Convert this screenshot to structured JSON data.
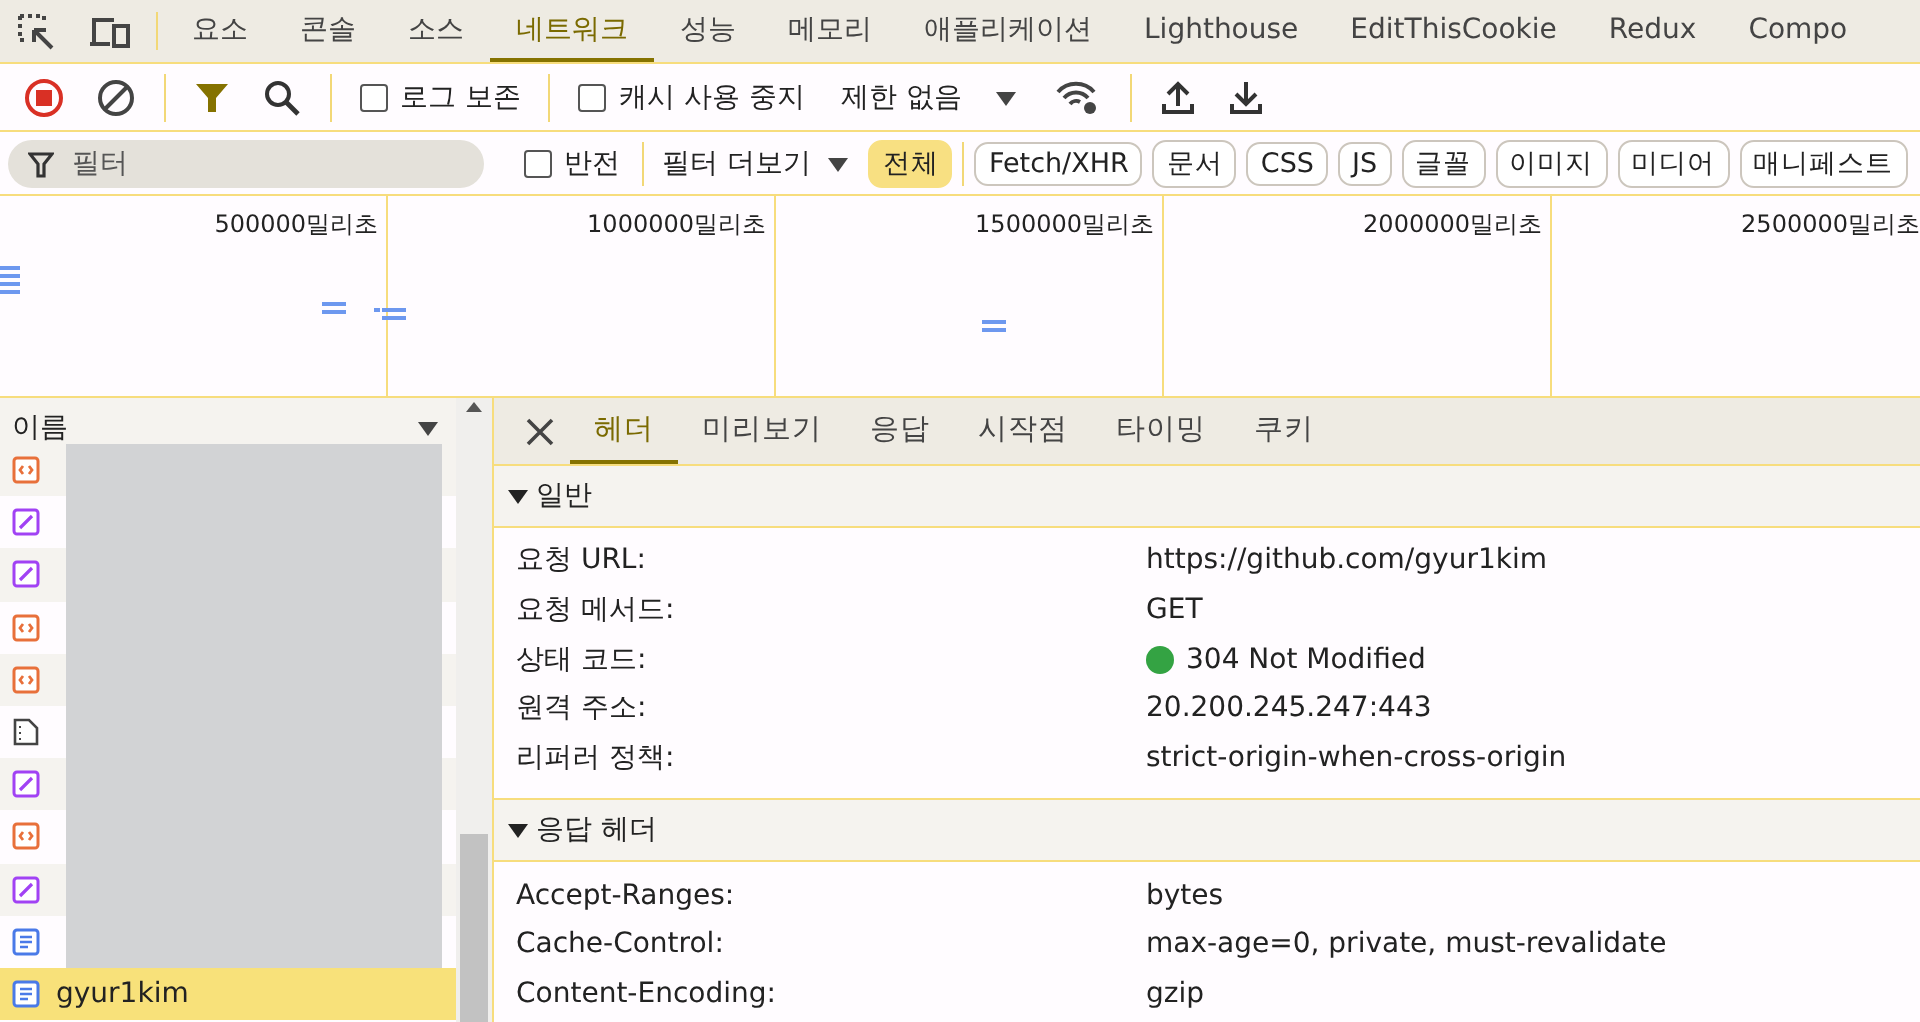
{
  "main_tabs": [
    {
      "label": "요소",
      "selected": false
    },
    {
      "label": "콘솔",
      "selected": false
    },
    {
      "label": "소스",
      "selected": false
    },
    {
      "label": "네트워크",
      "selected": true
    },
    {
      "label": "성능",
      "selected": false
    },
    {
      "label": "메모리",
      "selected": false
    },
    {
      "label": "애플리케이션",
      "selected": false
    },
    {
      "label": "Lighthouse",
      "selected": false
    },
    {
      "label": "EditThisCookie",
      "selected": false
    },
    {
      "label": "Redux",
      "selected": false
    },
    {
      "label": "Compo",
      "selected": false
    }
  ],
  "toolbar": {
    "recording": true,
    "filter_on": true,
    "preserve_log": {
      "label": "로그 보존",
      "checked": false
    },
    "disable_cache": {
      "label": "캐시 사용 중지",
      "checked": false
    },
    "throttling": "제한 없음"
  },
  "filter_bar": {
    "placeholder": "필터",
    "invert": {
      "label": "반전",
      "checked": false
    },
    "more_filters": "필터 더보기",
    "chips": [
      {
        "label": "전체",
        "selected": true
      },
      {
        "label": "Fetch/XHR",
        "selected": false
      },
      {
        "label": "문서",
        "selected": false
      },
      {
        "label": "CSS",
        "selected": false
      },
      {
        "label": "JS",
        "selected": false
      },
      {
        "label": "글꼴",
        "selected": false
      },
      {
        "label": "이미지",
        "selected": false
      },
      {
        "label": "미디어",
        "selected": false
      },
      {
        "label": "매니페스트",
        "selected": false
      }
    ]
  },
  "overview": {
    "ticks": [
      "500000밀리초",
      "1000000밀리초",
      "1500000밀리초",
      "2000000밀리초",
      "2500000밀리초"
    ]
  },
  "request_list": {
    "column": "이름",
    "rows": [
      {
        "kind": "script",
        "selected": false
      },
      {
        "kind": "stylesheet",
        "selected": false
      },
      {
        "kind": "stylesheet",
        "selected": false
      },
      {
        "kind": "script",
        "selected": false
      },
      {
        "kind": "script",
        "selected": false
      },
      {
        "kind": "other",
        "selected": false
      },
      {
        "kind": "stylesheet",
        "selected": false
      },
      {
        "kind": "script",
        "selected": false
      },
      {
        "kind": "stylesheet",
        "selected": false
      },
      {
        "kind": "document",
        "selected": false
      },
      {
        "kind": "document",
        "name": "gyur1kim",
        "selected": true
      }
    ]
  },
  "details": {
    "tabs": [
      {
        "label": "헤더",
        "selected": true
      },
      {
        "label": "미리보기",
        "selected": false
      },
      {
        "label": "응답",
        "selected": false
      },
      {
        "label": "시작점",
        "selected": false
      },
      {
        "label": "타이밍",
        "selected": false
      },
      {
        "label": "쿠키",
        "selected": false
      }
    ],
    "sections": [
      {
        "title": "일반",
        "expanded": true,
        "rows": [
          {
            "key": "요청 URL:",
            "value": "https://github.com/gyur1kim"
          },
          {
            "key": "요청 메서드:",
            "value": "GET"
          },
          {
            "key": "상태 코드:",
            "value": "304 Not Modified",
            "kind": "status"
          },
          {
            "key": "원격 주소:",
            "value": "20.200.245.247:443"
          },
          {
            "key": "리퍼러 정책:",
            "value": "strict-origin-when-cross-origin"
          }
        ]
      },
      {
        "title": "응답 헤더",
        "expanded": true,
        "rows": [
          {
            "key": "Accept-Ranges:",
            "value": "bytes"
          },
          {
            "key": "Cache-Control:",
            "value": "max-age=0, private, must-revalidate"
          },
          {
            "key": "Content-Encoding:",
            "value": "gzip"
          }
        ]
      }
    ]
  }
}
